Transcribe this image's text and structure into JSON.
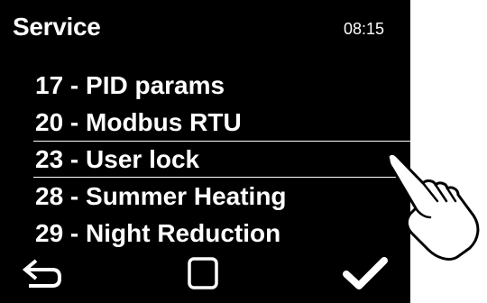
{
  "header": {
    "title": "Service",
    "time": "08:15"
  },
  "menu": {
    "items": [
      {
        "label": "17 - PID params",
        "selected": false
      },
      {
        "label": "20 - Modbus RTU",
        "selected": false
      },
      {
        "label": "23 - User lock",
        "selected": true
      },
      {
        "label": "28 - Summer Heating",
        "selected": false
      },
      {
        "label": "29 - Night Reduction",
        "selected": false
      }
    ]
  },
  "footer": {
    "buttons": [
      "back-arrow-icon",
      "square-icon",
      "checkmark-icon"
    ]
  },
  "overlay": {
    "icon": "pointing-hand-icon"
  },
  "colors": {
    "background": "#000000",
    "foreground": "#ffffff"
  }
}
